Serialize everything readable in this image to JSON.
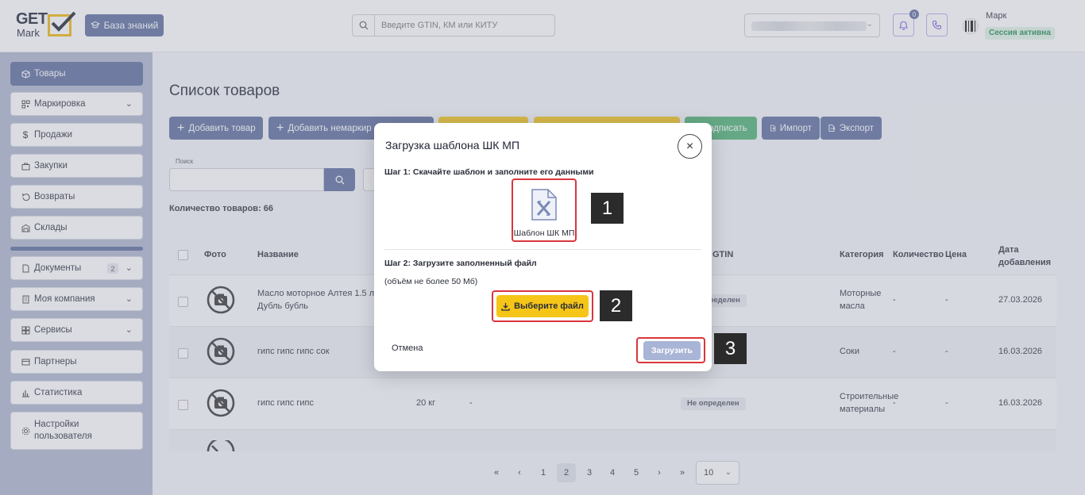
{
  "header": {
    "logo_top": "GET",
    "logo_bottom": "Mark",
    "kb_button": "База знаний",
    "search_placeholder": "Введите GTIN, КМ или КИТУ",
    "notification_count": "0",
    "user_name": "Марк",
    "session_status": "Сессия активна"
  },
  "sidebar": {
    "items": [
      {
        "label": "Товары",
        "icon": "cube-icon",
        "active": true
      },
      {
        "label": "Маркировка",
        "icon": "qr-icon",
        "chevron": true
      },
      {
        "label": "Продажи",
        "icon": "dollar-icon"
      },
      {
        "label": "Закупки",
        "icon": "bag-icon"
      },
      {
        "label": "Возвраты",
        "icon": "return-icon"
      },
      {
        "label": "Склады",
        "icon": "warehouse-icon"
      },
      {
        "label": "Документы",
        "icon": "document-icon",
        "chevron": true,
        "count": "2"
      },
      {
        "label": "Моя компания",
        "icon": "building-icon",
        "chevron": true
      },
      {
        "label": "Сервисы",
        "icon": "grid-icon",
        "chevron": true
      },
      {
        "label": "Партнеры",
        "icon": "partners-icon"
      },
      {
        "label": "Статистика",
        "icon": "chart-icon"
      },
      {
        "label": "Настройки пользователя",
        "icon": "gear-icon"
      }
    ]
  },
  "main": {
    "title": "Список товаров",
    "toolbar": {
      "add_product": "Добавить товар",
      "add_unmarked": "Добавить немаркир",
      "sign": "одписать",
      "import": "Импорт",
      "export": "Экспорт"
    },
    "search_label": "Поиск",
    "count_text": "Количество товаров: 66",
    "table": {
      "headers": {
        "photo": "Фото",
        "name": "Название",
        "gtin": "GTIN",
        "category": "Категория",
        "quantity": "Количество",
        "price": "Цена",
        "date_added": "Дата добавления"
      },
      "rows": [
        {
          "name": "Масло моторное Алтея 1.5 л Дубль бубль",
          "weight": "",
          "extra": "",
          "gtin_status": "определен",
          "category": "Моторные масла",
          "quantity": "-",
          "price": "-",
          "date": "27.03.2026"
        },
        {
          "name": "гипс гипс гипс сок",
          "weight": "",
          "extra": "",
          "gtin_status": "",
          "category": "Соки",
          "quantity": "-",
          "price": "-",
          "date": "16.03.2026"
        },
        {
          "name": "гипс гипс гипс",
          "weight": "20 кг",
          "extra": "-",
          "gtin_status": "Не определен",
          "category": "Строительные материалы",
          "quantity": "-",
          "price": "-",
          "date": "16.03.2026"
        }
      ]
    },
    "pagination": {
      "first": "«",
      "prev": "‹",
      "pages": [
        "1",
        "2",
        "3",
        "4",
        "5"
      ],
      "current": "2",
      "next": "›",
      "last": "»",
      "per_page": "10"
    }
  },
  "modal": {
    "title": "Загрузка шаблона ШК МП",
    "step1": "Шаг 1: Скачайте шаблон и заполните его данными",
    "template_file": "Шаблон ШК МП",
    "step2": "Шаг 2: Загрузите заполненный файл",
    "size_note": "(объём не более 50 Мб)",
    "choose_file": "Выберите файл",
    "cancel": "Отмена",
    "upload": "Загрузить",
    "close_glyph": "×"
  },
  "callouts": [
    "1",
    "2",
    "3"
  ],
  "colors": {
    "primary": "#5b6b9b",
    "accent_yellow": "#f5c518",
    "success_green": "#4caf70",
    "highlight_red": "#d9363e"
  }
}
